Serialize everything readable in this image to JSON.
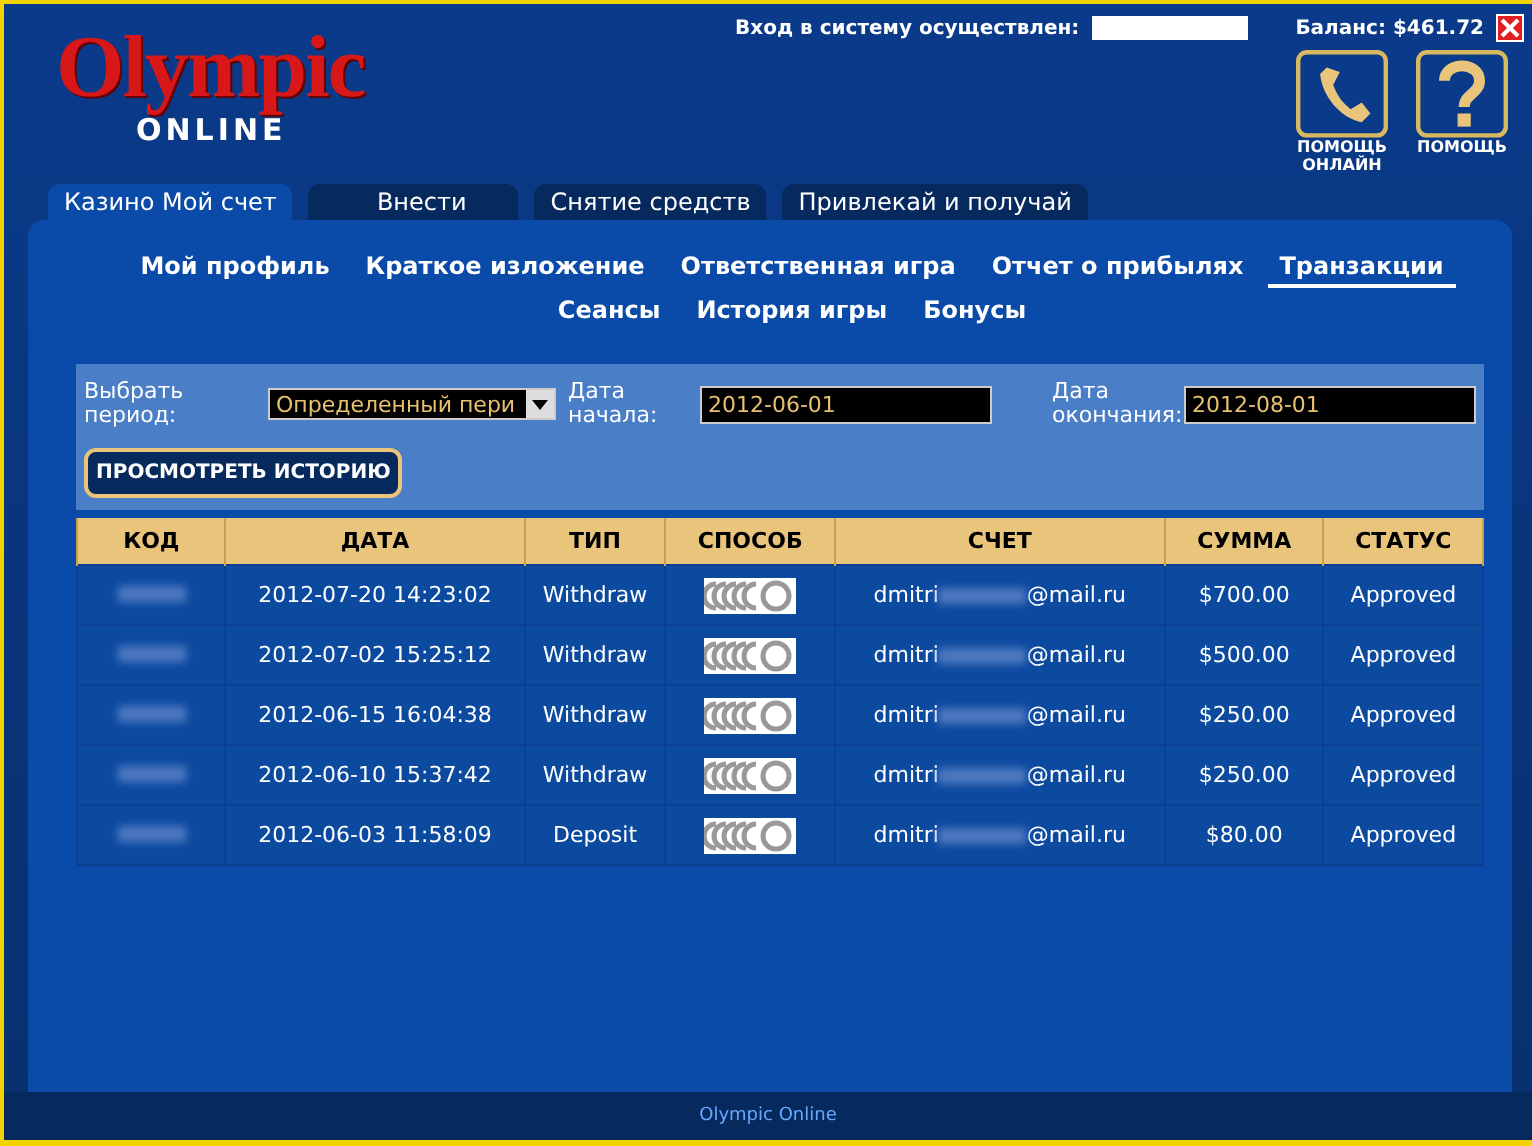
{
  "logo": {
    "title": "Olympic",
    "subtitle": "ONLINE"
  },
  "header": {
    "login_label": "Вход в систему осуществлен:",
    "balance": "Баланс: $461.72",
    "help_buttons": [
      {
        "kind": "phone",
        "label": "ПОМОЩЬ ОНЛАЙН"
      },
      {
        "kind": "question",
        "label": "ПОМОЩЬ"
      }
    ]
  },
  "tabs": [
    {
      "label": "Казино Мой счет",
      "selected": true
    },
    {
      "label": "Внести",
      "selected": false
    },
    {
      "label": "Снятие средств",
      "selected": false
    },
    {
      "label": "Привлекай и получай",
      "selected": false
    }
  ],
  "subnav": [
    {
      "label": "Мой профиль",
      "selected": false
    },
    {
      "label": "Краткое изложение",
      "selected": false
    },
    {
      "label": "Ответственная игра",
      "selected": false
    },
    {
      "label": "Отчет о прибылях",
      "selected": false
    },
    {
      "label": "Транзакции",
      "selected": true
    },
    {
      "label": "Сеансы",
      "selected": false
    },
    {
      "label": "История игры",
      "selected": false
    },
    {
      "label": "Бонусы",
      "selected": false
    }
  ],
  "filter": {
    "period_label": "Выбрать период:",
    "period_value": "Определенный пери",
    "start_label": "Дата начала:",
    "start_value": "2012-06-01",
    "end_label": "Дата окончания:",
    "end_value": "2012-08-01",
    "button": "ПРОСМОТРЕТЬ ИСТОРИЮ"
  },
  "table": {
    "columns": [
      "КОД",
      "ДАТА",
      "ТИП",
      "СПОСОБ",
      "СЧЕТ",
      "СУММА",
      "СТАТУС"
    ],
    "rows": [
      {
        "date": "2012-07-20 14:23:02",
        "type": "Withdraw",
        "account_start": "dmitri",
        "account_end": "@mail.ru",
        "amount": "$700.00",
        "status": "Approved"
      },
      {
        "date": "2012-07-02 15:25:12",
        "type": "Withdraw",
        "account_start": "dmitri",
        "account_end": "@mail.ru",
        "amount": "$500.00",
        "status": "Approved"
      },
      {
        "date": "2012-06-15 16:04:38",
        "type": "Withdraw",
        "account_start": "dmitri",
        "account_end": "@mail.ru",
        "amount": "$250.00",
        "status": "Approved"
      },
      {
        "date": "2012-06-10 15:37:42",
        "type": "Withdraw",
        "account_start": "dmitri",
        "account_end": "@mail.ru",
        "amount": "$250.00",
        "status": "Approved"
      },
      {
        "date": "2012-06-03 11:58:09",
        "type": "Deposit",
        "account_start": "dmitri",
        "account_end": "@mail.ru",
        "amount": "$80.00",
        "status": "Approved"
      }
    ]
  },
  "footer": "Olympic Online"
}
